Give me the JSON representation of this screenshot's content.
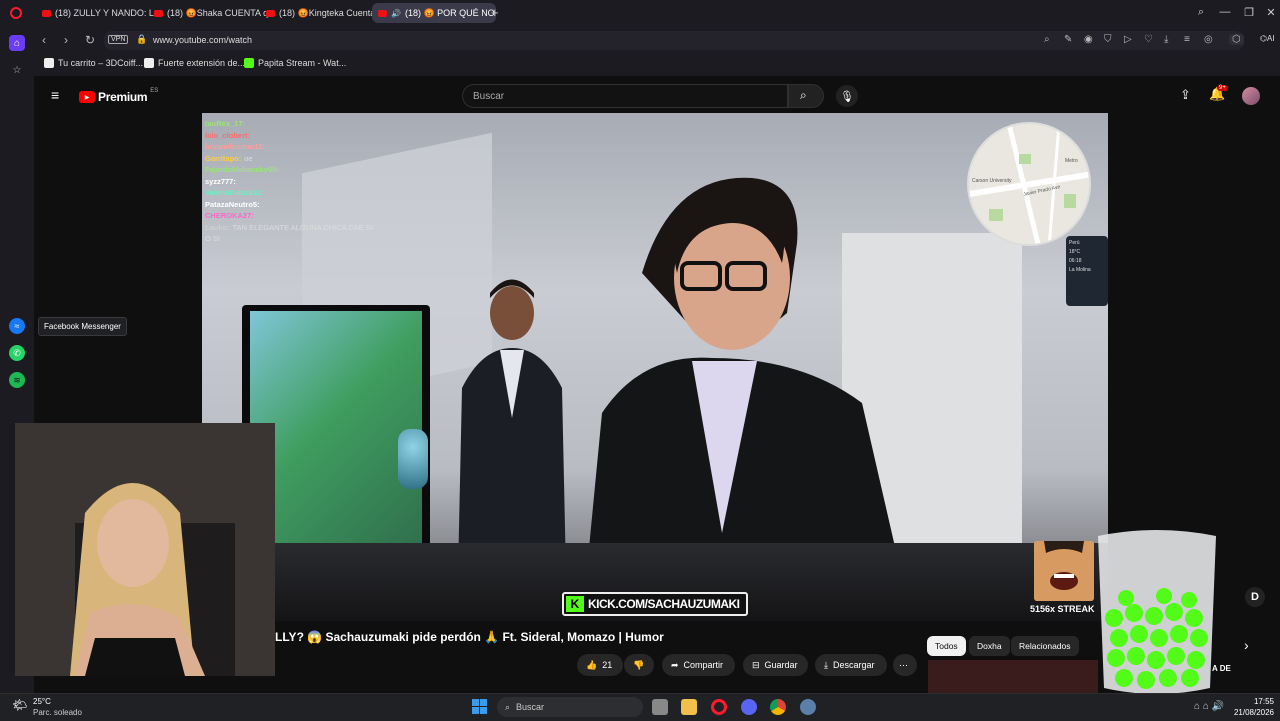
{
  "browser": {
    "tabs": [
      {
        "label": "(18) ZULLY Y NANDO: LA",
        "active": false
      },
      {
        "label": "(18) 😡Shaka CUENTA qu",
        "active": false
      },
      {
        "label": "(18) 😡Kingteka Cuenta c",
        "active": false
      },
      {
        "label": "(18) 😡 POR QUÉ NO",
        "active": true
      }
    ],
    "vpn_label": "VPN",
    "url": "www.youtube.com/watch",
    "ai_label": "AI",
    "bookmarks": [
      {
        "label": "Tu carrito – 3DCoiff..."
      },
      {
        "label": "Fuerte extensión de..."
      },
      {
        "label": "Papita Stream - Wat..."
      }
    ],
    "sidebar_tooltip": "Facebook Messenger",
    "colors": {
      "accent": "#e11d48",
      "kick_green": "#53fc18"
    }
  },
  "youtube": {
    "logo_text": "Premium",
    "region": "ES",
    "search_placeholder": "Buscar",
    "notification_count": "9+",
    "video_title": "LLY? 😱 Sachauzumaki pide perdón 🙏 Ft. Sideral, Momazo | Humor",
    "actions": {
      "like_count": "21",
      "share": "Compartir",
      "save": "Guardar",
      "download": "Descargar"
    },
    "chips": [
      {
        "label": "Todos",
        "selected": true
      },
      {
        "label": "Doxha",
        "selected": false
      },
      {
        "label": "Relacionados",
        "selected": false
      }
    ],
    "recommendation_snippet": "A DE"
  },
  "stream_overlay": {
    "chat": [
      {
        "user": "tauRex_17:",
        "msg": "",
        "color": "#9be37a"
      },
      {
        "user": "lolo_clobert:",
        "msg": "",
        "color": "#ff6b6b"
      },
      {
        "user": "bryanvhismar12:",
        "msg": "",
        "color": "#ff9e9e"
      },
      {
        "user": "Garritapo:",
        "msg": "oe",
        "color": "#ffcc44"
      },
      {
        "user": "FajardoMakanaky69:",
        "msg": "",
        "color": "#9be37a"
      },
      {
        "user": "syzz777:",
        "msg": "",
        "color": "#ffffff"
      },
      {
        "user": "ValeriaPataza31:",
        "msg": "",
        "color": "#6cf0c2"
      },
      {
        "user": "PatazaNeutro5:",
        "msg": "",
        "color": "#ffffff"
      },
      {
        "user": "CHEROKA27:",
        "msg": "",
        "color": "#ff66cc"
      },
      {
        "user": "Lauko:",
        "msg": "TAN ELEGANTE ALGUNA CHICA CAE SI O SI",
        "color": "#cfcfcf"
      }
    ],
    "kick_url": "KICK.COM/SACHAUZUMAKI",
    "streak_text": "5156x STREAK",
    "weather_widget": {
      "city": "Perú",
      "temp": "18°C",
      "time": "06:18",
      "place": "La Molina"
    },
    "map_labels": [
      "Javier Prado Ave",
      "Carson University",
      "Metro"
    ]
  },
  "taskbar": {
    "weather_temp": "25°C",
    "weather_desc": "Parc. soleado",
    "search_label": "Buscar",
    "time": "17:55",
    "date": "21/08/2026"
  }
}
